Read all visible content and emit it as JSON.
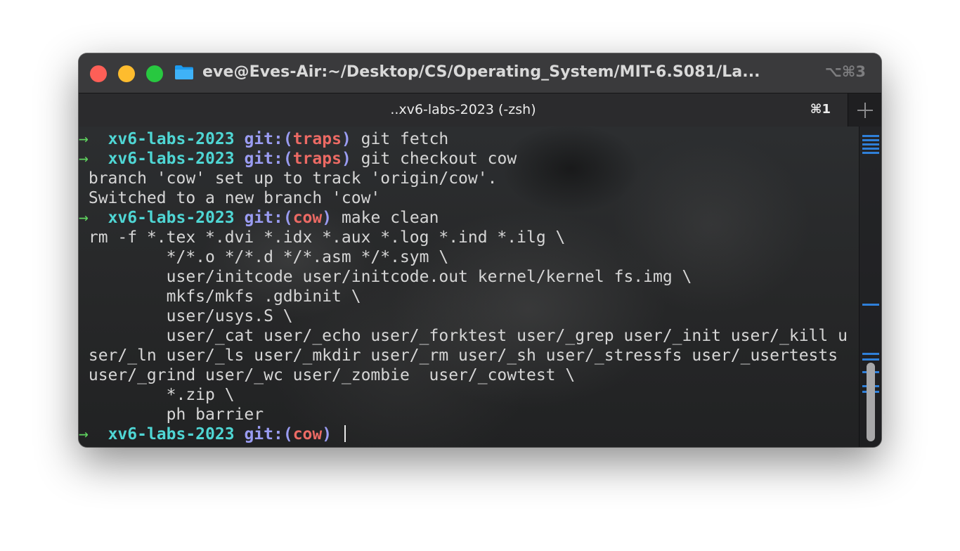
{
  "window": {
    "title": "eve@Eves-Air:~/Desktop/CS/Operating_System/MIT-6.S081/La...",
    "shortcut": "⌥⌘3"
  },
  "tab": {
    "title": "..xv6-labs-2023 (-zsh)",
    "shortcut": "⌘1",
    "add_label": "+"
  },
  "terminal": {
    "prompt_arrow": "→",
    "prompt_dir": "xv6-labs-2023",
    "git_prefix": "git:(",
    "git_suffix": ")",
    "lines": [
      {
        "branch": "traps",
        "command": "git fetch"
      },
      {
        "branch": "traps",
        "command": "git checkout cow"
      },
      {
        "text": "branch 'cow' set up to track 'origin/cow'."
      },
      {
        "text": "Switched to a new branch 'cow'"
      },
      {
        "branch": "cow",
        "command": "make clean"
      },
      {
        "text": "rm -f *.tex *.dvi *.idx *.aux *.log *.ind *.ilg \\"
      },
      {
        "text": "        */*.o */*.d */*.asm */*.sym \\"
      },
      {
        "text": "        user/initcode user/initcode.out kernel/kernel fs.img \\"
      },
      {
        "text": "        mkfs/mkfs .gdbinit \\"
      },
      {
        "text": "        user/usys.S \\"
      },
      {
        "text": "        user/_cat user/_echo user/_forktest user/_grep user/_init user/_kill u"
      },
      {
        "text": "ser/_ln user/_ls user/_mkdir user/_rm user/_sh user/_stressfs user/_usertests"
      },
      {
        "text": "user/_grind user/_wc user/_zombie  user/_cowtest \\"
      },
      {
        "text": "        *.zip \\"
      },
      {
        "text": "        ph barrier"
      },
      {
        "branch": "cow",
        "command": ""
      }
    ]
  },
  "colors": {
    "arrow": "#5fd35f",
    "dir": "#4fd6d4",
    "git": "#9a9cf2",
    "branch": "#ec6a64",
    "scroll_marks": "#2f7fd8"
  }
}
